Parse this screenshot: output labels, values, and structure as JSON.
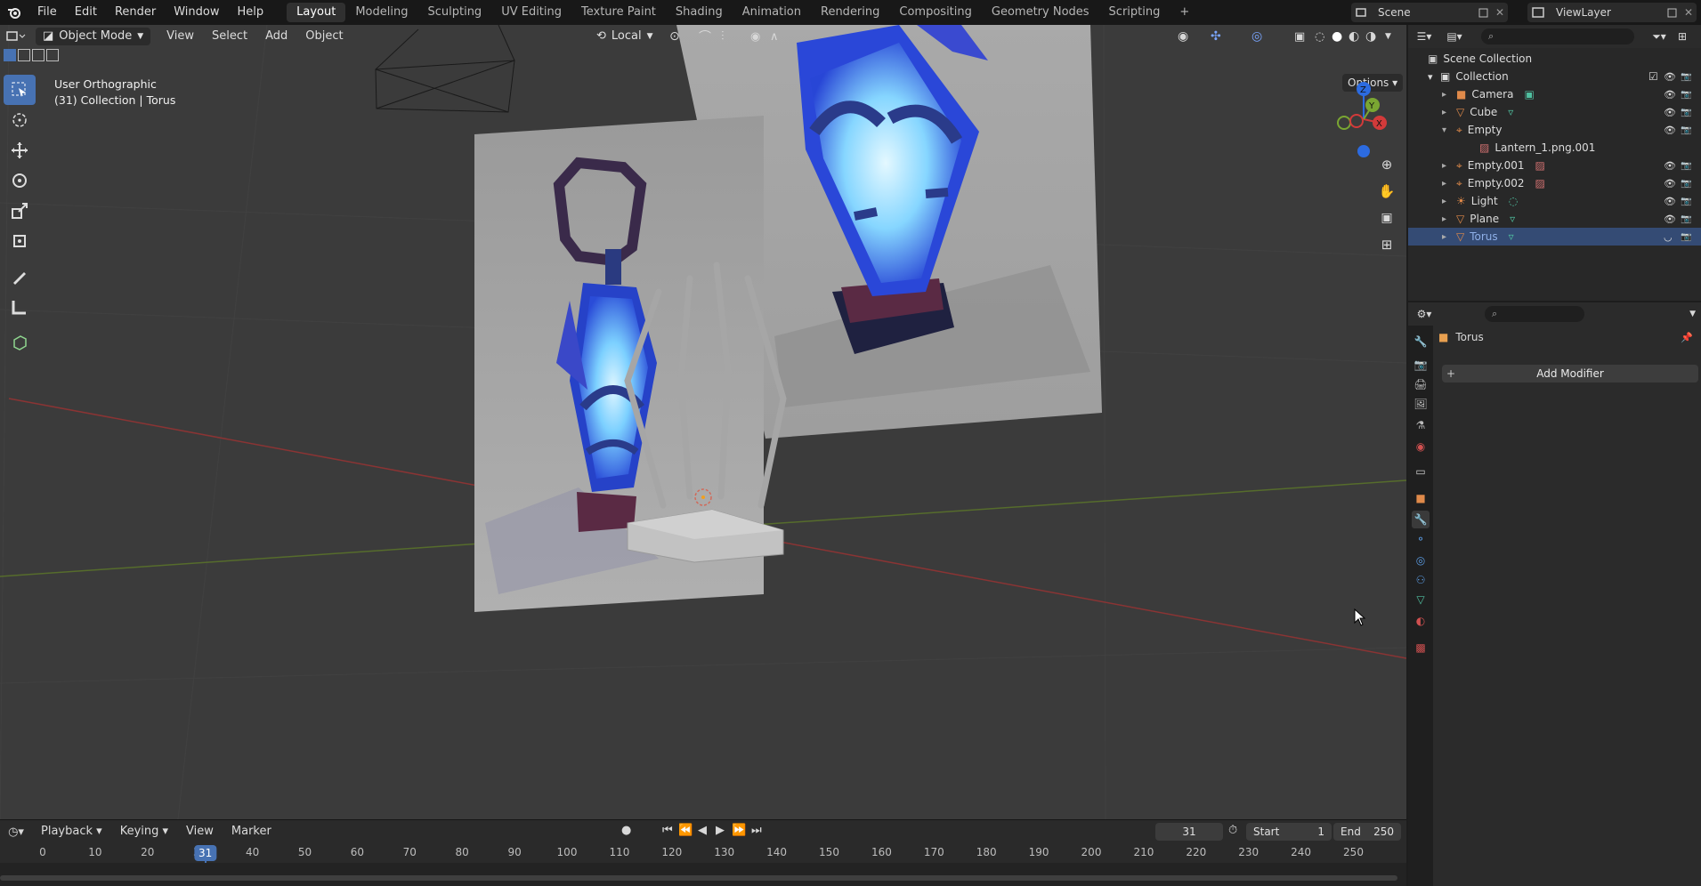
{
  "app": {
    "name": "Blender"
  },
  "menu": [
    "File",
    "Edit",
    "Render",
    "Window",
    "Help"
  ],
  "workspaces": [
    "Layout",
    "Modeling",
    "Sculpting",
    "UV Editing",
    "Texture Paint",
    "Shading",
    "Animation",
    "Rendering",
    "Compositing",
    "Geometry Nodes",
    "Scripting"
  ],
  "active_workspace": "Layout",
  "scene": {
    "name": "Scene",
    "view_layer": "ViewLayer"
  },
  "viewport": {
    "mode": "Object Mode",
    "menus": [
      "View",
      "Select",
      "Add",
      "Object"
    ],
    "transform_orientation": "Local",
    "options_label": "Options",
    "view_name": "User Orthographic",
    "context": "(31) Collection | Torus"
  },
  "timeline": {
    "menus": [
      "Playback",
      "Keying",
      "View",
      "Marker"
    ],
    "current_frame": "31",
    "start_label": "Start",
    "start": "1",
    "end_label": "End",
    "end": "250",
    "ticks": [
      "0",
      "10",
      "20",
      "30",
      "40",
      "50",
      "60",
      "70",
      "80",
      "90",
      "100",
      "110",
      "120",
      "130",
      "140",
      "150",
      "160",
      "170",
      "180",
      "190",
      "200",
      "210",
      "220",
      "230",
      "240",
      "250"
    ],
    "marker_frame": "31"
  },
  "outliner": {
    "root": "Scene Collection",
    "collection": "Collection",
    "items": [
      {
        "name": "Camera",
        "icon": "camera-icon",
        "data_icon": "camera-data-icon",
        "expanded": false,
        "selected": false
      },
      {
        "name": "Cube",
        "icon": "mesh-icon",
        "data_icon": "mesh-data-icon",
        "expanded": false,
        "selected": false
      },
      {
        "name": "Empty",
        "icon": "empty-icon",
        "data_icon": "",
        "expanded": true,
        "selected": false
      },
      {
        "name": "Lantern_1.png.001",
        "icon": "image-icon",
        "data_icon": "",
        "child": true,
        "selected": false
      },
      {
        "name": "Empty.001",
        "icon": "empty-icon",
        "data_icon": "image-icon",
        "expanded": false,
        "selected": false
      },
      {
        "name": "Empty.002",
        "icon": "empty-icon",
        "data_icon": "image-icon",
        "expanded": false,
        "selected": false
      },
      {
        "name": "Light",
        "icon": "light-icon",
        "data_icon": "light-data-icon",
        "expanded": false,
        "selected": false
      },
      {
        "name": "Plane",
        "icon": "mesh-icon",
        "data_icon": "mesh-data-icon",
        "expanded": false,
        "selected": false
      },
      {
        "name": "Torus",
        "icon": "mesh-icon",
        "data_icon": "mesh-data-icon",
        "expanded": false,
        "selected": true
      }
    ]
  },
  "properties": {
    "object_name": "Torus",
    "add_modifier": "Add Modifier",
    "tabs": [
      "tool",
      "render",
      "output",
      "view-layer",
      "scene",
      "world",
      "collection",
      "object",
      "modifiers",
      "particles",
      "physics",
      "constraints",
      "data",
      "material",
      "texture"
    ],
    "active_tab": "modifiers"
  },
  "colors": {
    "accent": "#4772b3",
    "selected_row": "#344b74",
    "x_axis": "#a63a3a",
    "y_axis": "#5c7a2e",
    "lantern_glow": "#6fc3ff"
  }
}
